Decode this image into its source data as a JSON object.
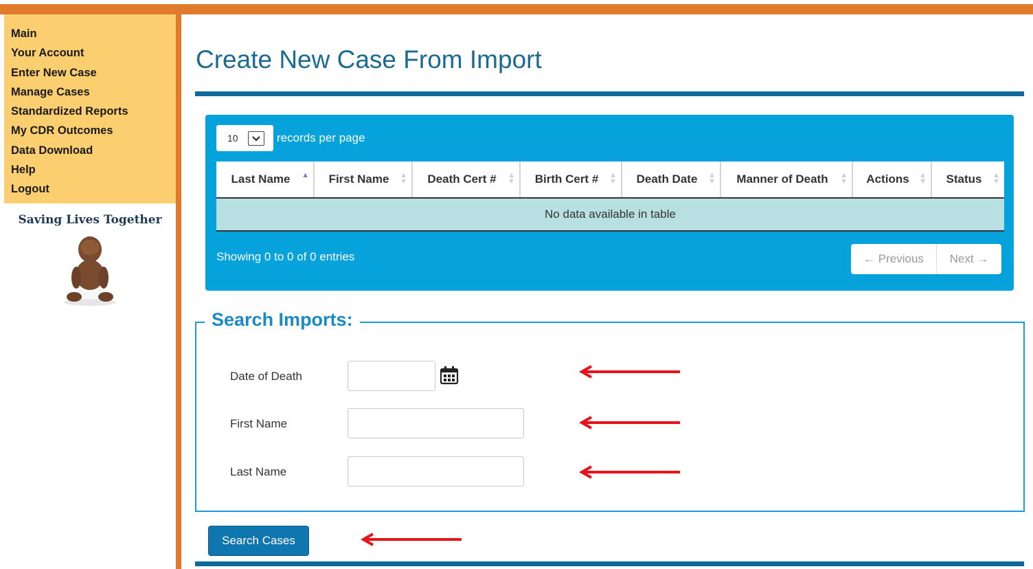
{
  "sidebar": {
    "nav": [
      "Main",
      "Your Account",
      "Enter New Case",
      "Manage Cases",
      "Standardized Reports",
      "My CDR Outcomes",
      "Data Download",
      "Help",
      "Logout"
    ],
    "tagline": "Saving Lives Together"
  },
  "page": {
    "title": "Create New Case From Import"
  },
  "table": {
    "length_value": "10",
    "length_label": "records per page",
    "columns": [
      "Last Name",
      "First Name",
      "Death Cert #",
      "Birth Cert #",
      "Death Date",
      "Manner of Death",
      "Actions",
      "Status"
    ],
    "empty_message": "No data available in table",
    "info": "Showing 0 to 0 of 0 entries",
    "prev": "← Previous",
    "next": "Next →"
  },
  "search": {
    "legend": "Search Imports:",
    "date_of_death_label": "Date of Death",
    "first_name_label": "First Name",
    "last_name_label": "Last Name",
    "date_of_death_value": "",
    "first_name_value": "",
    "last_name_value": "",
    "button": "Search Cases"
  },
  "colors": {
    "accent_orange": "#e07b2e",
    "panel_blue": "#05a2dc",
    "title_blue": "#1a6a96",
    "arrow_red": "#e8121a"
  }
}
